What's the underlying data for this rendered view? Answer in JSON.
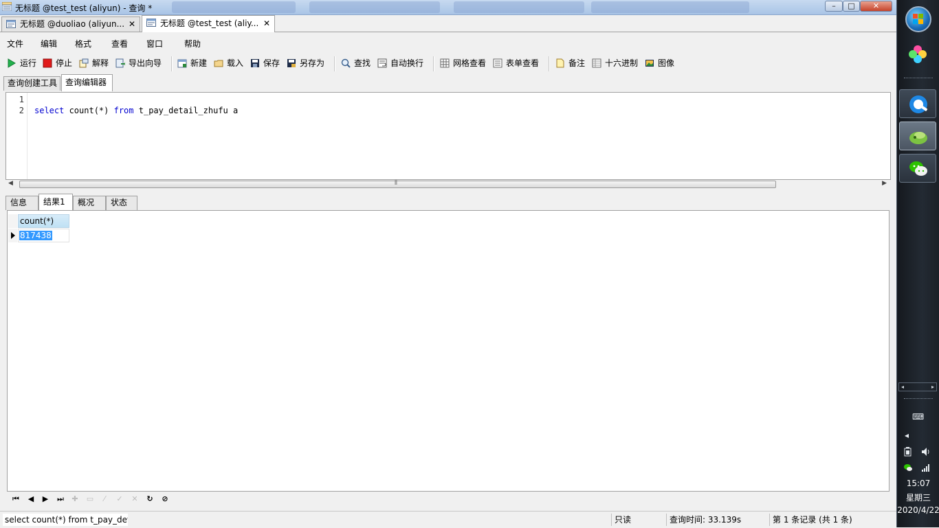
{
  "window": {
    "title": "无标题 @test_test (aliyun) - 查询 *",
    "minimize": "–",
    "maximize": "□",
    "close": "✕"
  },
  "doc_tabs": [
    {
      "label": "无标题 @duoliao (aliyun...",
      "close": "✕",
      "active": false
    },
    {
      "label": "无标题 @test_test (aliy...",
      "close": "✕",
      "active": true
    }
  ],
  "menu": [
    "文件",
    "编辑",
    "格式",
    "查看",
    "窗口",
    "帮助"
  ],
  "toolbar": {
    "run": "运行",
    "stop": "停止",
    "explain": "解释",
    "export_wizard": "导出向导",
    "new": "新建",
    "load": "载入",
    "save": "保存",
    "save_as": "另存为",
    "find": "查找",
    "word_wrap": "自动换行",
    "grid_view": "网格查看",
    "form_view": "表单查看",
    "memo": "备注",
    "hex": "十六进制",
    "image": "图像"
  },
  "editor_tabs": [
    {
      "label": "查询创建工具",
      "active": false
    },
    {
      "label": "查询编辑器",
      "active": true
    }
  ],
  "editor": {
    "line_numbers": [
      "1",
      "2"
    ],
    "lines": [
      "",
      "select count(*) from t_pay_detail_zhufu a"
    ],
    "tokens": {
      "select_kw": "select",
      "count_expr": " count(*) ",
      "from_kw": "from",
      "rest": " t_pay_detail_zhufu a"
    },
    "scroll_grip": "⦀"
  },
  "result_tabs": [
    {
      "label": "信息",
      "active": false
    },
    {
      "label": "结果1",
      "active": true
    },
    {
      "label": "概况",
      "active": false
    },
    {
      "label": "状态",
      "active": false
    }
  ],
  "results": {
    "columns": [
      "count(*)"
    ],
    "rows": [
      [
        "817438"
      ]
    ]
  },
  "navigator": {
    "first": "⏮",
    "prev": "◀",
    "next": "▶",
    "last": "⏭",
    "add": "✚",
    "delete": "▭",
    "edit": "⁄",
    "apply": "✓",
    "cancel": "✕",
    "refresh": "↻",
    "stop": "⊘"
  },
  "status": {
    "sql": "select count(*) from t_pay_deta",
    "readonly": "只读",
    "query_time": "查询时间: 33.139s",
    "record": "第 1 条记录 (共 1 条)"
  },
  "taskbar": {
    "time": "15:07",
    "day": "星期三",
    "date": "2020/4/22",
    "tray_left": "◂",
    "tray_right": "▸",
    "volume": "🔊",
    "network": "📶",
    "expand": "◂",
    "keyboard": "⌨"
  },
  "colors": {
    "keyword": "#0000d0",
    "selection": "#3399ff",
    "header_bg": "#bfe0f4",
    "stop_red": "#e11a1a",
    "run_green": "#22b14c"
  }
}
